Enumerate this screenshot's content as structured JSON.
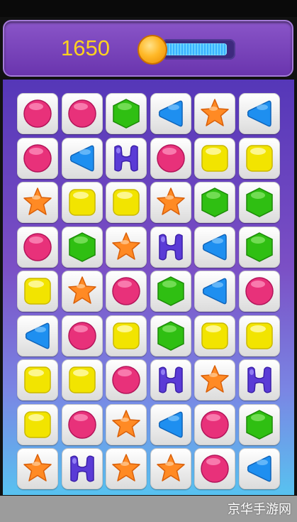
{
  "header": {
    "score": "1650",
    "progress": 0.92
  },
  "board": {
    "rows": [
      [
        "circle",
        "circle",
        "hexagon",
        "triangle",
        "star",
        "triangle"
      ],
      [
        "circle",
        "triangle",
        "h",
        "circle",
        "square",
        "square"
      ],
      [
        "star",
        "square",
        "square",
        "star",
        "hexagon",
        "hexagon"
      ],
      [
        "circle",
        "hexagon",
        "star",
        "h",
        "triangle",
        "hexagon"
      ],
      [
        "square",
        "star",
        "circle",
        "hexagon",
        "triangle",
        "circle"
      ],
      [
        "triangle",
        "circle",
        "square",
        "hexagon",
        "square",
        "square"
      ],
      [
        "square",
        "square",
        "circle",
        "h",
        "star",
        "h"
      ],
      [
        "square",
        "circle",
        "star",
        "triangle",
        "circle",
        "hexagon"
      ],
      [
        "star",
        "h",
        "star",
        "star",
        "circle",
        "triangle"
      ]
    ]
  },
  "colors": {
    "circle": "#e8317a",
    "hexagon": "#2fbf12",
    "triangle": "#1e8ff0",
    "star": "#ff8a24",
    "square": "#f2e400",
    "h": "#5a3bd6"
  },
  "watermark": "京华手游网"
}
